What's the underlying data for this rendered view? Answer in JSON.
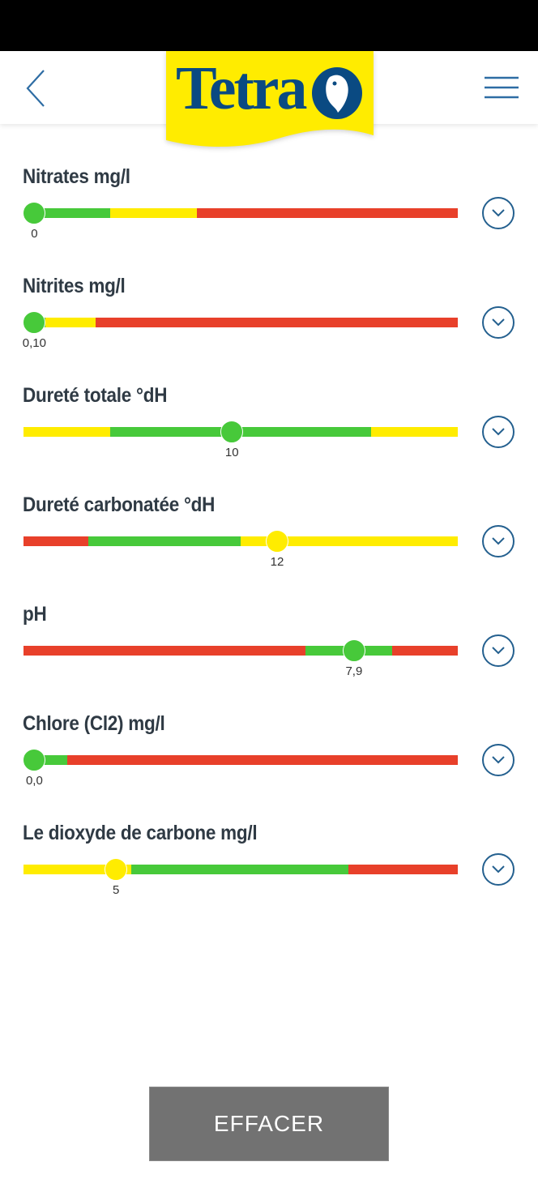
{
  "header": {
    "logo_text": "Tetra",
    "back_icon": "chevron-left-icon",
    "menu_icon": "hamburger-menu-icon"
  },
  "colors": {
    "green": "#47c93a",
    "yellow": "#ffec00",
    "red": "#e8402a",
    "brand_blue": "#0a4a82",
    "brand_yellow": "#ffec00",
    "button_gray": "#727272"
  },
  "parameters": [
    {
      "title": "Nitrates mg/l",
      "value": "0",
      "position": 0.025,
      "thumb_color": "green",
      "segments": [
        {
          "color": "green",
          "from": 0.0,
          "to": 0.2
        },
        {
          "color": "yellow",
          "from": 0.2,
          "to": 0.4
        },
        {
          "color": "red",
          "from": 0.4,
          "to": 1.0
        }
      ]
    },
    {
      "title": "Nitrites mg/l",
      "value": "0,10",
      "position": 0.025,
      "thumb_color": "green",
      "segments": [
        {
          "color": "green",
          "from": 0.0,
          "to": 0.05
        },
        {
          "color": "yellow",
          "from": 0.05,
          "to": 0.166
        },
        {
          "color": "red",
          "from": 0.166,
          "to": 1.0
        }
      ]
    },
    {
      "title": "Dureté totale °dH",
      "value": "10",
      "position": 0.48,
      "thumb_color": "green",
      "segments": [
        {
          "color": "yellow",
          "from": 0.0,
          "to": 0.2
        },
        {
          "color": "green",
          "from": 0.2,
          "to": 0.8
        },
        {
          "color": "yellow",
          "from": 0.8,
          "to": 1.0
        }
      ]
    },
    {
      "title": "Dureté carbonatée °dH",
      "value": "12",
      "position": 0.584,
      "thumb_color": "yellow",
      "segments": [
        {
          "color": "red",
          "from": 0.0,
          "to": 0.15
        },
        {
          "color": "green",
          "from": 0.15,
          "to": 0.5
        },
        {
          "color": "yellow",
          "from": 0.5,
          "to": 1.0
        }
      ]
    },
    {
      "title": "pH",
      "value": "7,9",
      "position": 0.761,
      "thumb_color": "green",
      "segments": [
        {
          "color": "red",
          "from": 0.0,
          "to": 0.649
        },
        {
          "color": "green",
          "from": 0.649,
          "to": 0.849
        },
        {
          "color": "red",
          "from": 0.849,
          "to": 1.0
        }
      ]
    },
    {
      "title": "Chlore (Cl2) mg/l",
      "value": "0,0",
      "position": 0.025,
      "thumb_color": "green",
      "segments": [
        {
          "color": "green",
          "from": 0.0,
          "to": 0.1
        },
        {
          "color": "red",
          "from": 0.1,
          "to": 1.0
        }
      ]
    },
    {
      "title": "Le dioxyde de carbone mg/l",
      "value": "5",
      "position": 0.213,
      "thumb_color": "yellow",
      "segments": [
        {
          "color": "yellow",
          "from": 0.0,
          "to": 0.248
        },
        {
          "color": "green",
          "from": 0.248,
          "to": 0.748
        },
        {
          "color": "red",
          "from": 0.748,
          "to": 1.0
        }
      ]
    }
  ],
  "actions": {
    "clear_label": "EFFACER"
  }
}
